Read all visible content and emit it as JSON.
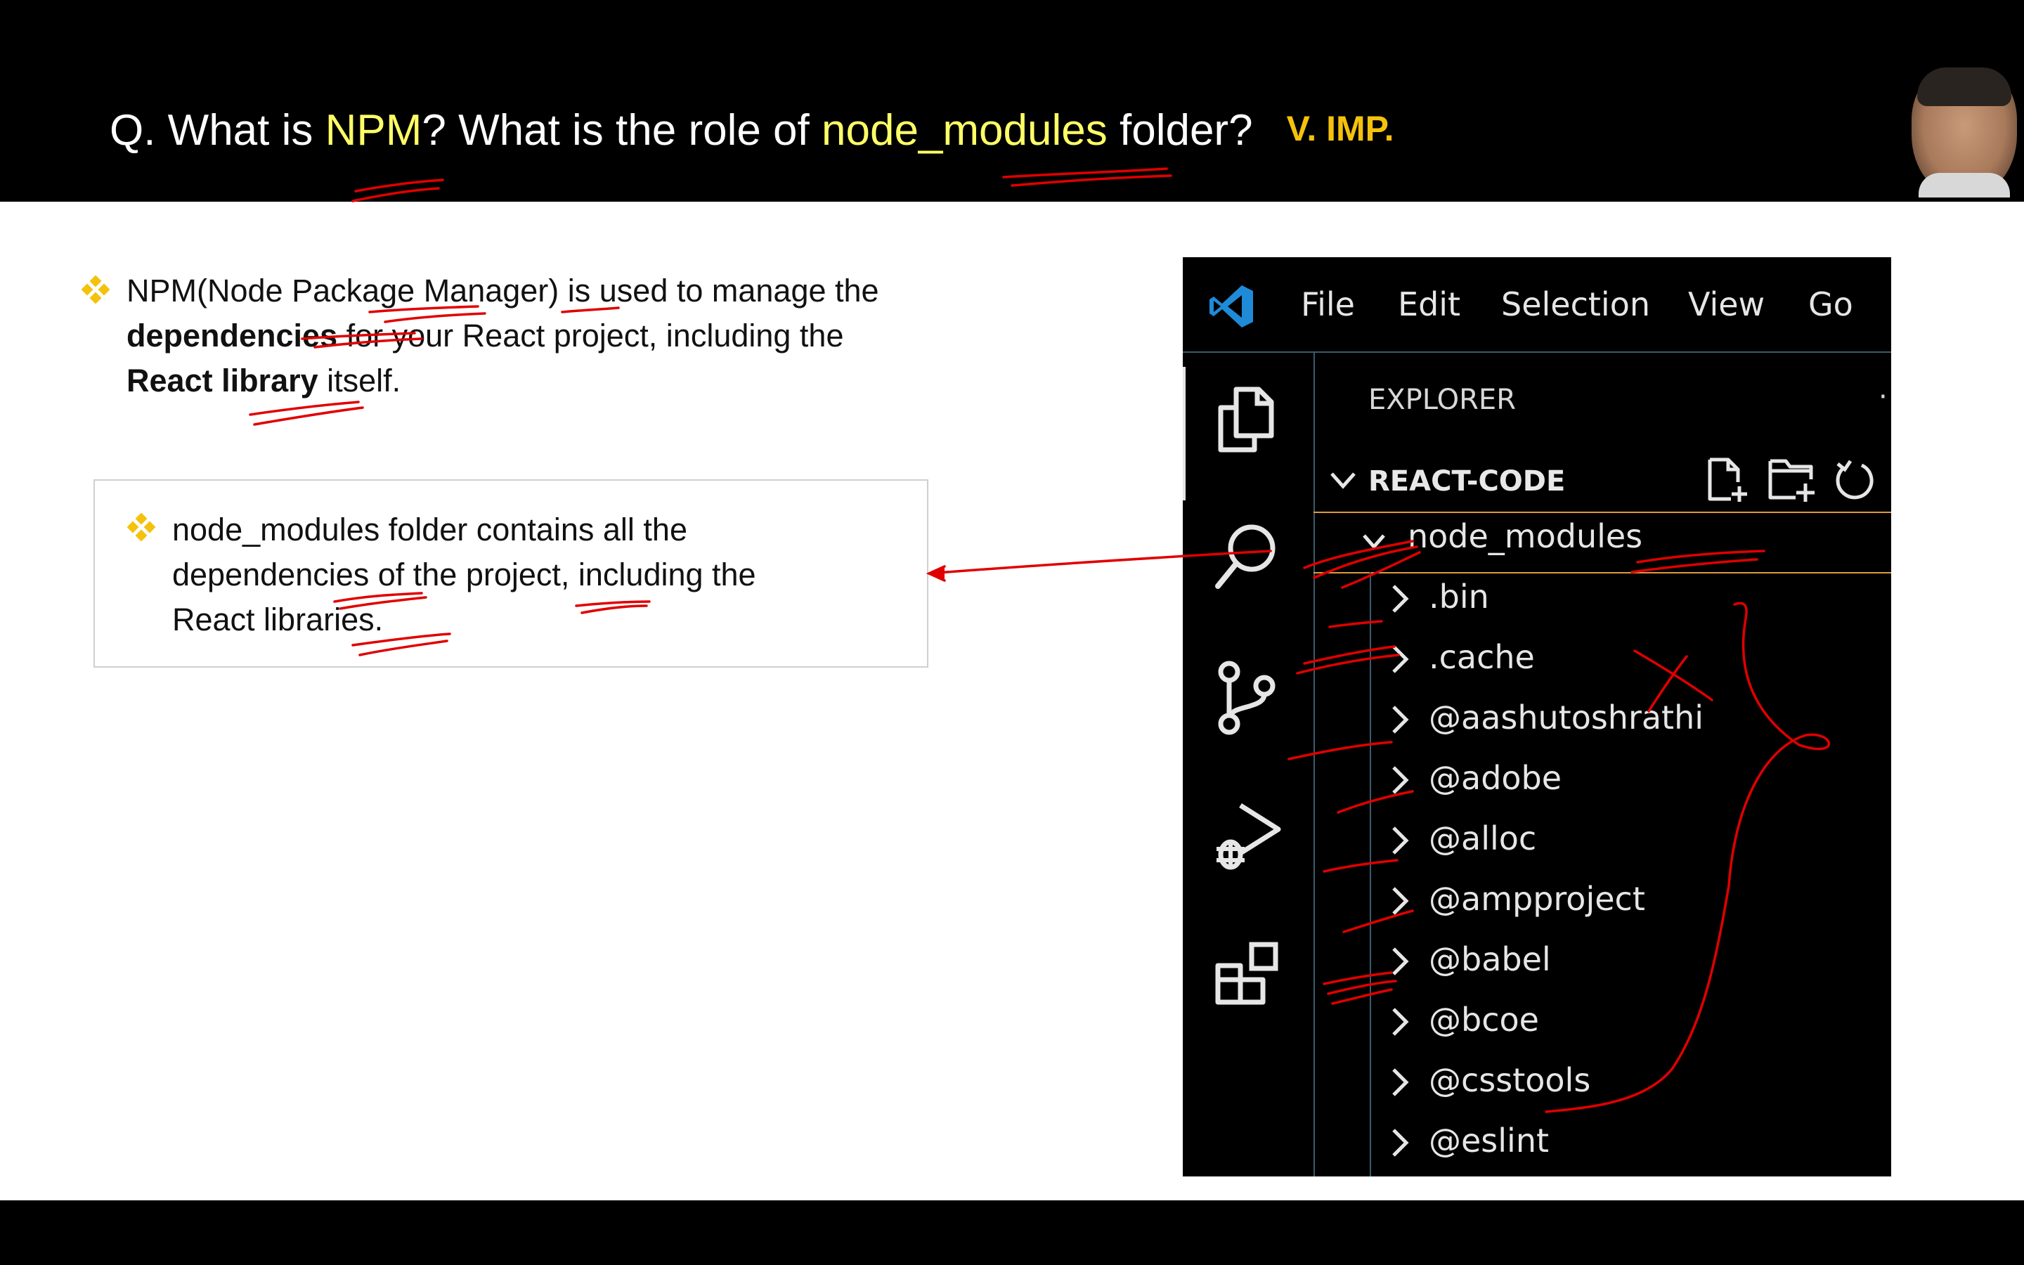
{
  "slide": {
    "title_prefix": "Q. What is ",
    "title_npm": "NPM",
    "title_mid": "? What is the role of ",
    "title_nm": "node_modules",
    "title_suffix": " folder?",
    "imp_badge": "V. IMP.",
    "bullet1_a": "NPM(Node Package Manager) is used to manage the",
    "bullet1_b_bold": "dependencies",
    "bullet1_b_rest": " for your React project, including the",
    "bullet1_c_bold": "React library",
    "bullet1_c_rest": " itself.",
    "box_line1": "node_modules folder contains all the",
    "box_line2": "dependencies of the project, including the",
    "box_line3": "React libraries."
  },
  "vscode": {
    "menu": [
      "File",
      "Edit",
      "Selection",
      "View",
      "Go"
    ],
    "explorer_label": "EXPLORER",
    "more_dot": "·",
    "root_folder": "REACT-CODE",
    "open_folder": "node_modules",
    "items": [
      ".bin",
      ".cache",
      "@aashutoshrathi",
      "@adobe",
      "@alloc",
      "@ampproject",
      "@babel",
      "@bcoe",
      "@csstools",
      "@eslint"
    ]
  },
  "colors": {
    "highlight": "#ffff66",
    "imp": "#f4c20d",
    "annotation": "#e00000",
    "bullet": "#f4c20d"
  },
  "icons": [
    "vscode-logo-icon",
    "files-icon",
    "search-icon",
    "source-control-icon",
    "run-debug-icon",
    "extensions-icon",
    "new-file-icon",
    "new-folder-icon",
    "refresh-icon",
    "chevron-down-icon",
    "chevron-right-icon",
    "diamond-bullet-icon"
  ]
}
